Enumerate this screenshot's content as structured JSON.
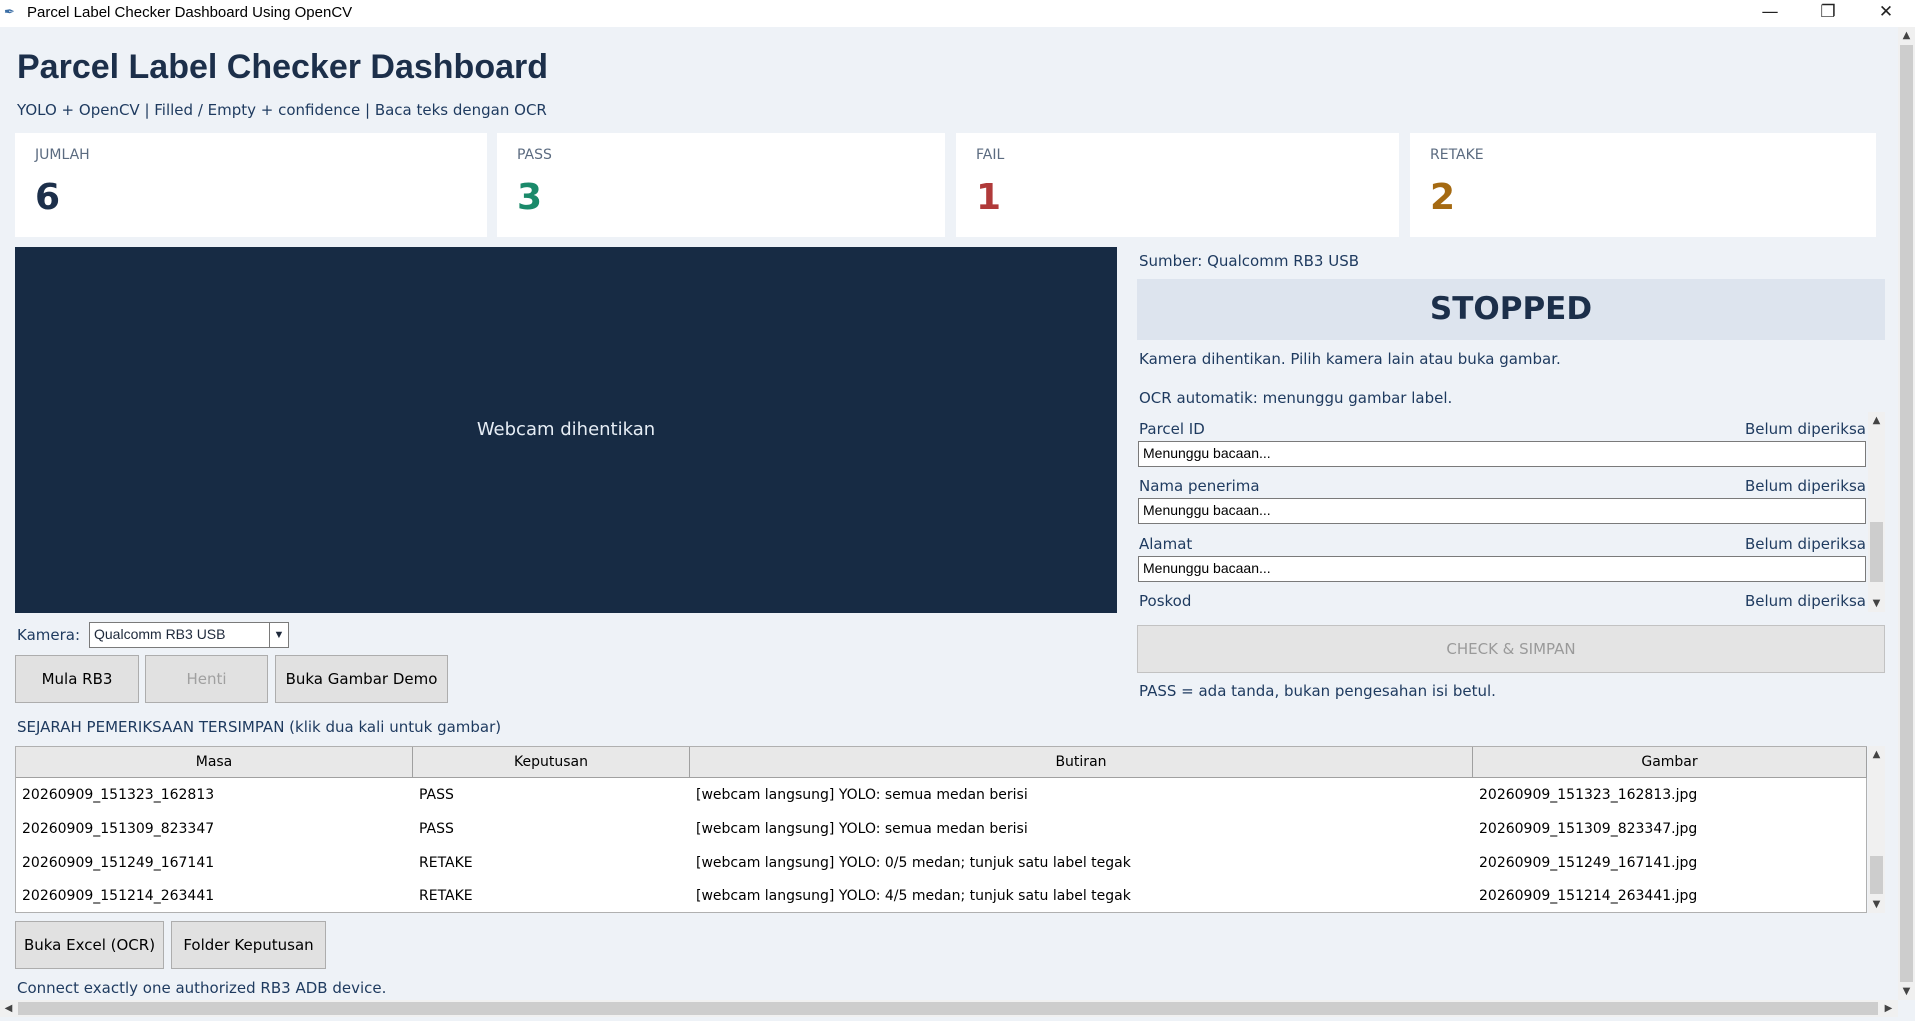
{
  "window": {
    "title": "Parcel Label Checker Dashboard Using OpenCV",
    "icon": "feather-icon",
    "minimize": "—",
    "restore": "❐",
    "close": "✕"
  },
  "header": {
    "title": "Parcel Label Checker Dashboard",
    "subtitle": "YOLO + OpenCV  |  Filled / Empty + confidence  |  Baca teks dengan OCR"
  },
  "stats": [
    {
      "label": "JUMLAH",
      "value": "6",
      "color": "#1c2f4a"
    },
    {
      "label": "PASS",
      "value": "3",
      "color": "#1a8a6a"
    },
    {
      "label": "FAIL",
      "value": "1",
      "color": "#b03a3a"
    },
    {
      "label": "RETAKE",
      "value": "2",
      "color": "#a56a12"
    }
  ],
  "webcam": {
    "message": "Webcam dihentikan"
  },
  "panel": {
    "source": "Sumber: Qualcomm RB3 USB",
    "status": "STOPPED",
    "info": "Kamera dihentikan. Pilih kamera lain atau buka gambar.",
    "ocr_status": "OCR automatik: menunggu gambar label.",
    "fields": [
      {
        "label": "Parcel ID",
        "status": "Belum diperiksa",
        "value": "Menunggu bacaan..."
      },
      {
        "label": "Nama penerima",
        "status": "Belum diperiksa",
        "value": "Menunggu bacaan..."
      },
      {
        "label": "Alamat",
        "status": "Belum diperiksa",
        "value": "Menunggu bacaan..."
      },
      {
        "label": "Poskod",
        "status": "Belum diperiksa"
      }
    ],
    "check_button": "CHECK & SIMPAN",
    "note": "PASS = ada tanda, bukan pengesahan isi betul."
  },
  "camera": {
    "label": "Kamera:",
    "selected": "Qualcomm RB3 USB",
    "buttons": {
      "start": "Mula RB3",
      "stop": "Henti",
      "demo": "Buka Gambar Demo"
    }
  },
  "history": {
    "title": "SEJARAH PEMERIKSAAN TERSIMPAN (klik dua kali untuk gambar)",
    "columns": [
      "Masa",
      "Keputusan",
      "Butiran",
      "Gambar"
    ],
    "rows": [
      [
        "20260909_151323_162813",
        "PASS",
        "[webcam langsung] YOLO: semua medan berisi",
        "20260909_151323_162813.jpg"
      ],
      [
        "20260909_151309_823347",
        "PASS",
        "[webcam langsung] YOLO: semua medan berisi",
        "20260909_151309_823347.jpg"
      ],
      [
        "20260909_151249_167141",
        "RETAKE",
        "[webcam langsung] YOLO: 0/5 medan; tunjuk satu label tegak",
        "20260909_151249_167141.jpg"
      ],
      [
        "20260909_151214_263441",
        "RETAKE",
        "[webcam langsung] YOLO: 4/5 medan; tunjuk satu label tegak",
        "20260909_151214_263441.jpg"
      ]
    ]
  },
  "bottom_buttons": {
    "excel": "Buka Excel (OCR)",
    "folder": "Folder Keputusan"
  },
  "footer": {
    "note": "Connect exactly one authorized RB3 ADB device."
  }
}
